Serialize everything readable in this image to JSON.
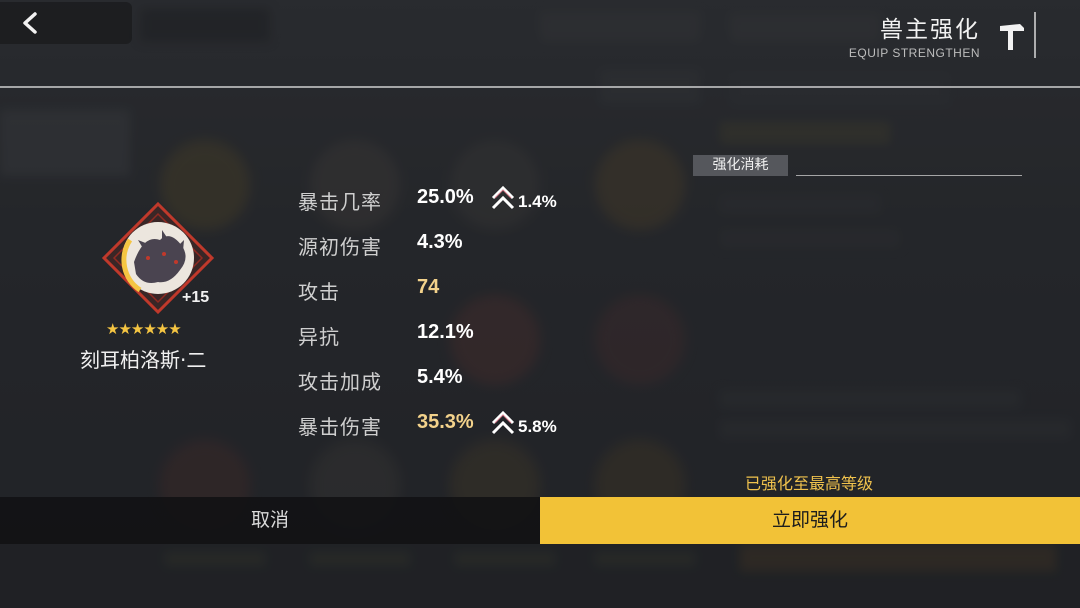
{
  "header": {
    "title": "兽主强化",
    "subtitle": "EQUIP STRENGTHEN",
    "back_icon": "chevron-left-icon",
    "tool_icon": "hammer-icon"
  },
  "item": {
    "name": "刻耳柏洛斯·二",
    "level": "+15",
    "stars": "★★★★★★",
    "star_count": 6,
    "icon": "three-headed-wolf-emblem"
  },
  "stats": [
    {
      "label": "暴击几率",
      "value": "25.0%",
      "increase": "1.4%",
      "highlight": false
    },
    {
      "label": "源初伤害",
      "value": "4.3%",
      "increase": "",
      "highlight": false
    },
    {
      "label": "攻击",
      "value": "74",
      "increase": "",
      "highlight": true
    },
    {
      "label": "异抗",
      "value": "12.1%",
      "increase": "",
      "highlight": false
    },
    {
      "label": "攻击加成",
      "value": "5.4%",
      "increase": "",
      "highlight": false
    },
    {
      "label": "暴击伤害",
      "value": "35.3%",
      "increase": "5.8%",
      "highlight": true
    }
  ],
  "cost": {
    "label": "强化消耗"
  },
  "status": {
    "maxed_note": "已强化至最高等级"
  },
  "buttons": {
    "cancel": "取消",
    "strengthen": "立即强化"
  },
  "colors": {
    "accent": "#f2c237",
    "highlight_value": "#f3d28b",
    "note": "#f0c24d",
    "emblem_red": "#c0392b",
    "emblem_gold": "#f5c542"
  }
}
